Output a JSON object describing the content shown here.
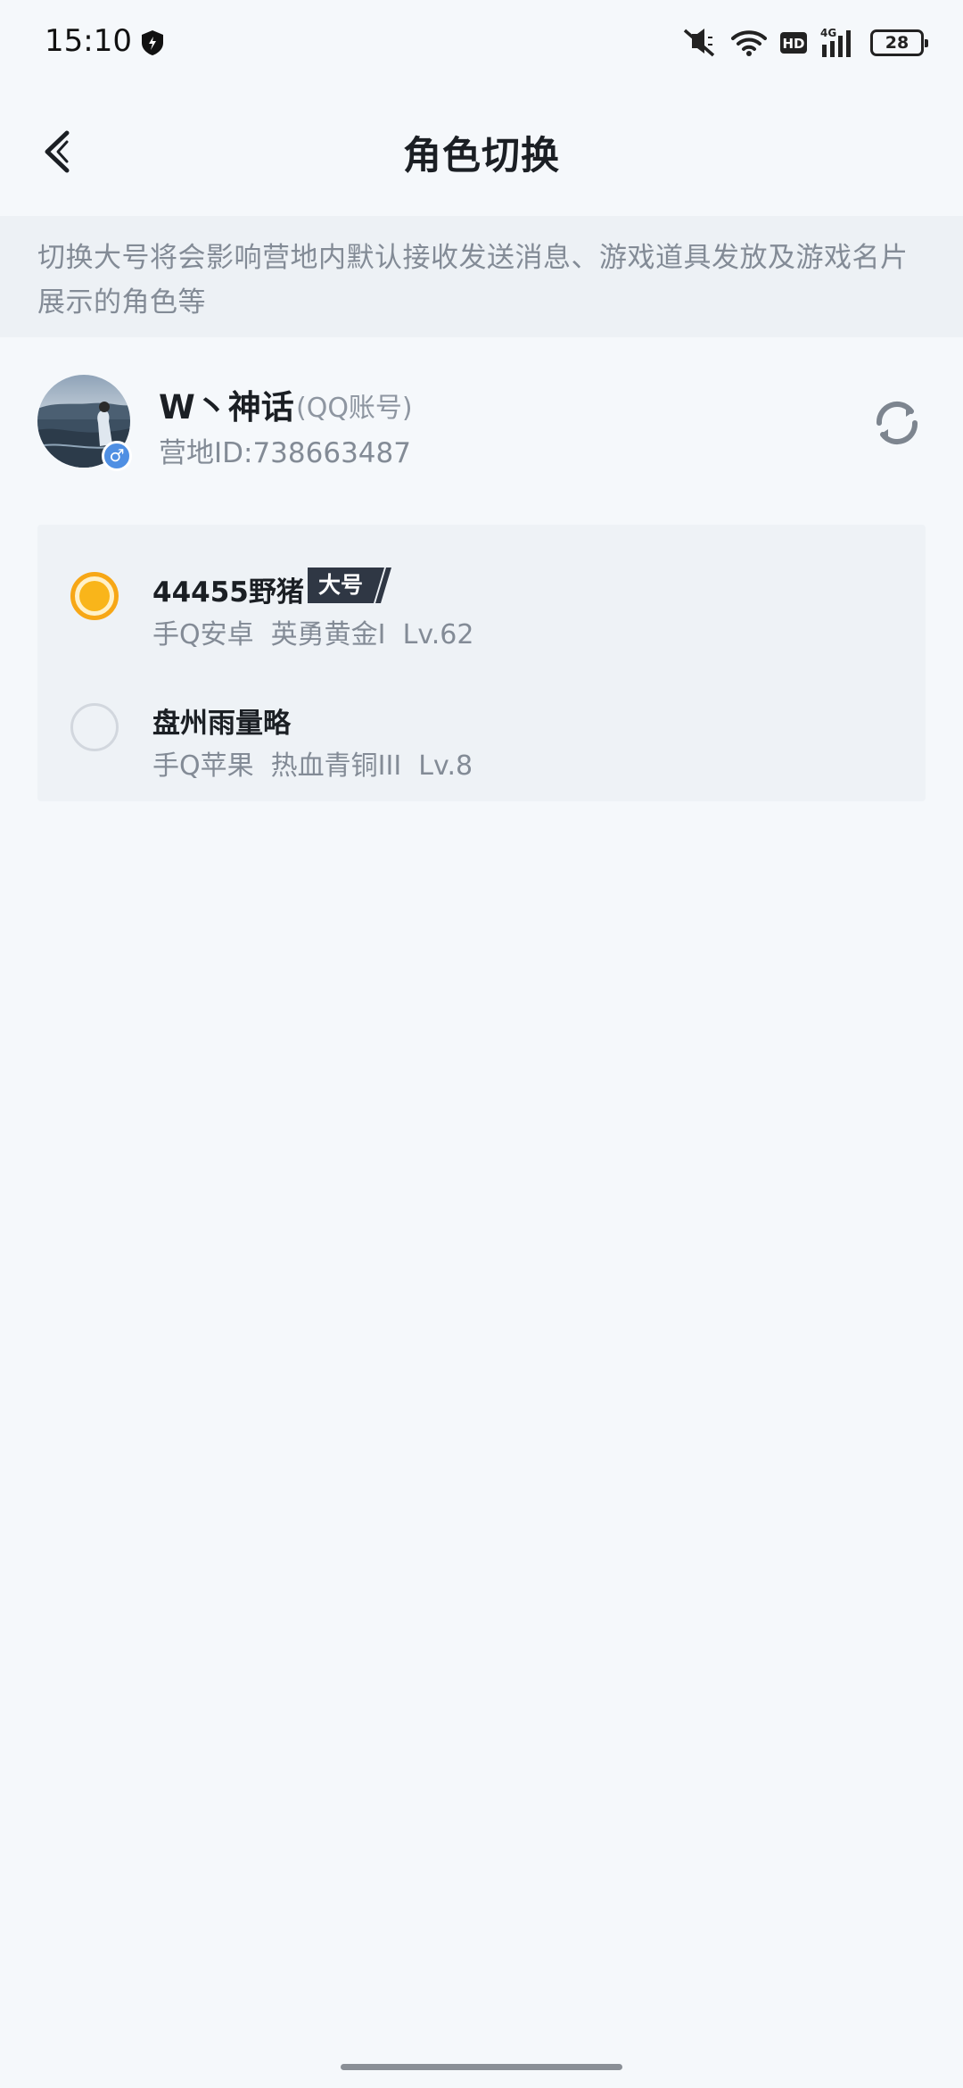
{
  "status_bar": {
    "time": "15:10",
    "battery": "28",
    "icons": [
      "shield-icon",
      "mute-icon",
      "wifi-icon",
      "hd-icon",
      "signal-4g-icon",
      "battery-icon"
    ]
  },
  "header": {
    "title": "角色切换",
    "back_icon": "chevron-left-icon"
  },
  "notice": {
    "text": "切换大号将会影响营地内默认接收发送消息、游戏道具发放及游戏名片展示的角色等"
  },
  "account": {
    "name": "W丶神话",
    "type": "(QQ账号)",
    "camp_id": "营地ID:738663487",
    "gender_icon": "male-icon",
    "refresh_icon": "refresh-icon"
  },
  "roles": [
    {
      "name": "44455野猪",
      "badge": "大号",
      "platform": "手Q安卓",
      "rank": "英勇黄金I",
      "level": "Lv.62",
      "meta": "手Q安卓  英勇黄金I  Lv.62",
      "selected": true
    },
    {
      "name": "盘州雨量略",
      "platform": "手Q苹果",
      "rank": "热血青铜III",
      "level": "Lv.8",
      "meta": "手Q苹果  热血青铜III  Lv.8",
      "selected": false
    }
  ],
  "colors": {
    "accent": "#f9b51a",
    "background": "#f5f8fb",
    "badge_bg": "#2f3744"
  }
}
